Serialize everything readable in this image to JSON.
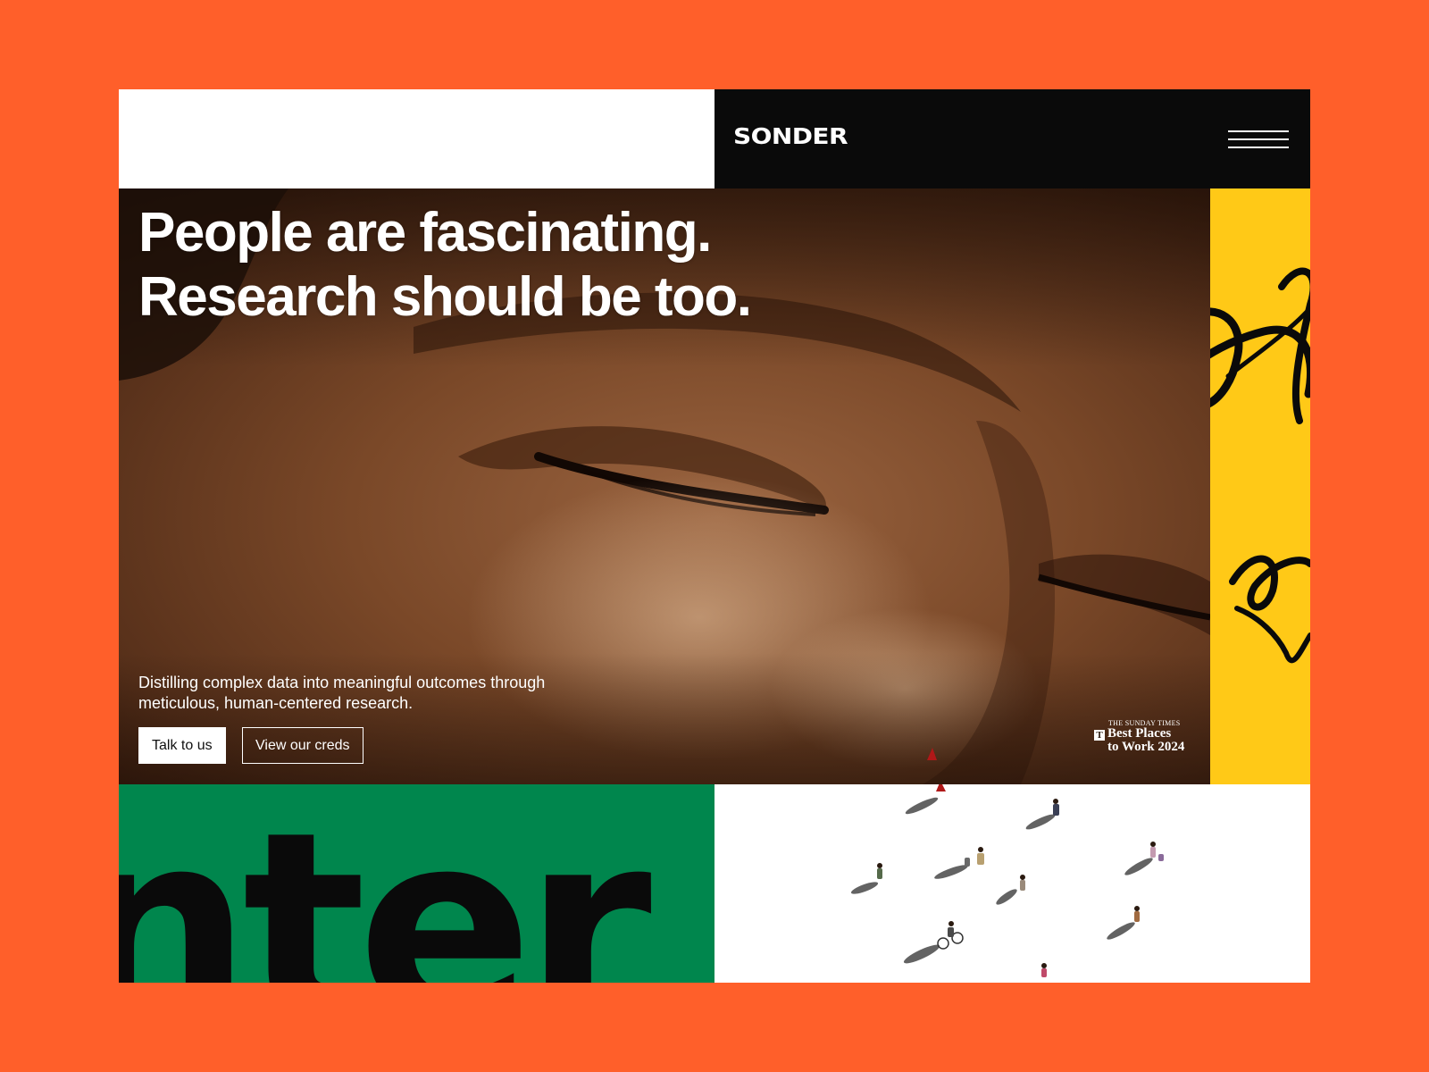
{
  "header": {
    "logo": "SONDER",
    "menu_icon": "hamburger-menu-icon"
  },
  "hero": {
    "headline_line1": "People are fascinating.",
    "headline_line2": "Research should be too.",
    "subcopy": "Distilling complex data into meaningful outcomes through meticulous, human-centered research.",
    "primary_cta": "Talk to us",
    "secondary_cta": "View our creds",
    "badge": {
      "publication": "THE SUNDAY TIMES",
      "t_mark": "T",
      "line1": "Best Places",
      "line2": "to Work 2024"
    }
  },
  "bottom": {
    "big_word": "nter"
  },
  "colors": {
    "background": "#FF5F2A",
    "header_dark": "#0A0A0A",
    "yellow_panel": "#FFC917",
    "green_panel": "#00864D",
    "white": "#FFFFFF"
  }
}
